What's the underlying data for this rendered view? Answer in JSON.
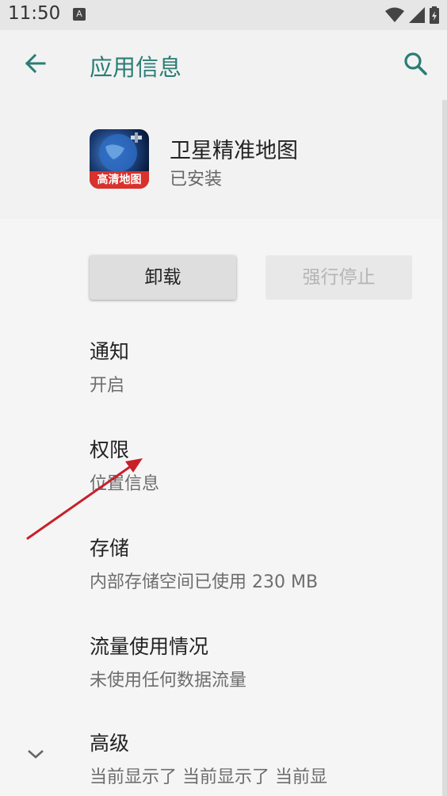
{
  "status_bar": {
    "time": "11:50",
    "notif_icon_letter": "A"
  },
  "app_bar": {
    "title": "应用信息"
  },
  "app": {
    "name": "卫星精准地图",
    "status": "已安装",
    "icon_banner": "高清地图"
  },
  "buttons": {
    "uninstall": "卸载",
    "force_stop": "强行停止"
  },
  "prefs": [
    {
      "title": "通知",
      "summary": "开启"
    },
    {
      "title": "权限",
      "summary": "位置信息"
    },
    {
      "title": "存储",
      "summary": "内部存储空间已使用 230 MB"
    },
    {
      "title": "流量使用情况",
      "summary": "未使用任何数据流量"
    },
    {
      "title": "高级",
      "summary": "当前显示了 当前显示了 当前显"
    }
  ],
  "colors": {
    "accent": "#2a7d75",
    "annotation_arrow": "#c8202a"
  },
  "icons": [
    "back-arrow-icon",
    "search-icon",
    "expand-chevron-icon",
    "wifi-icon",
    "signal-icon",
    "battery-icon"
  ]
}
